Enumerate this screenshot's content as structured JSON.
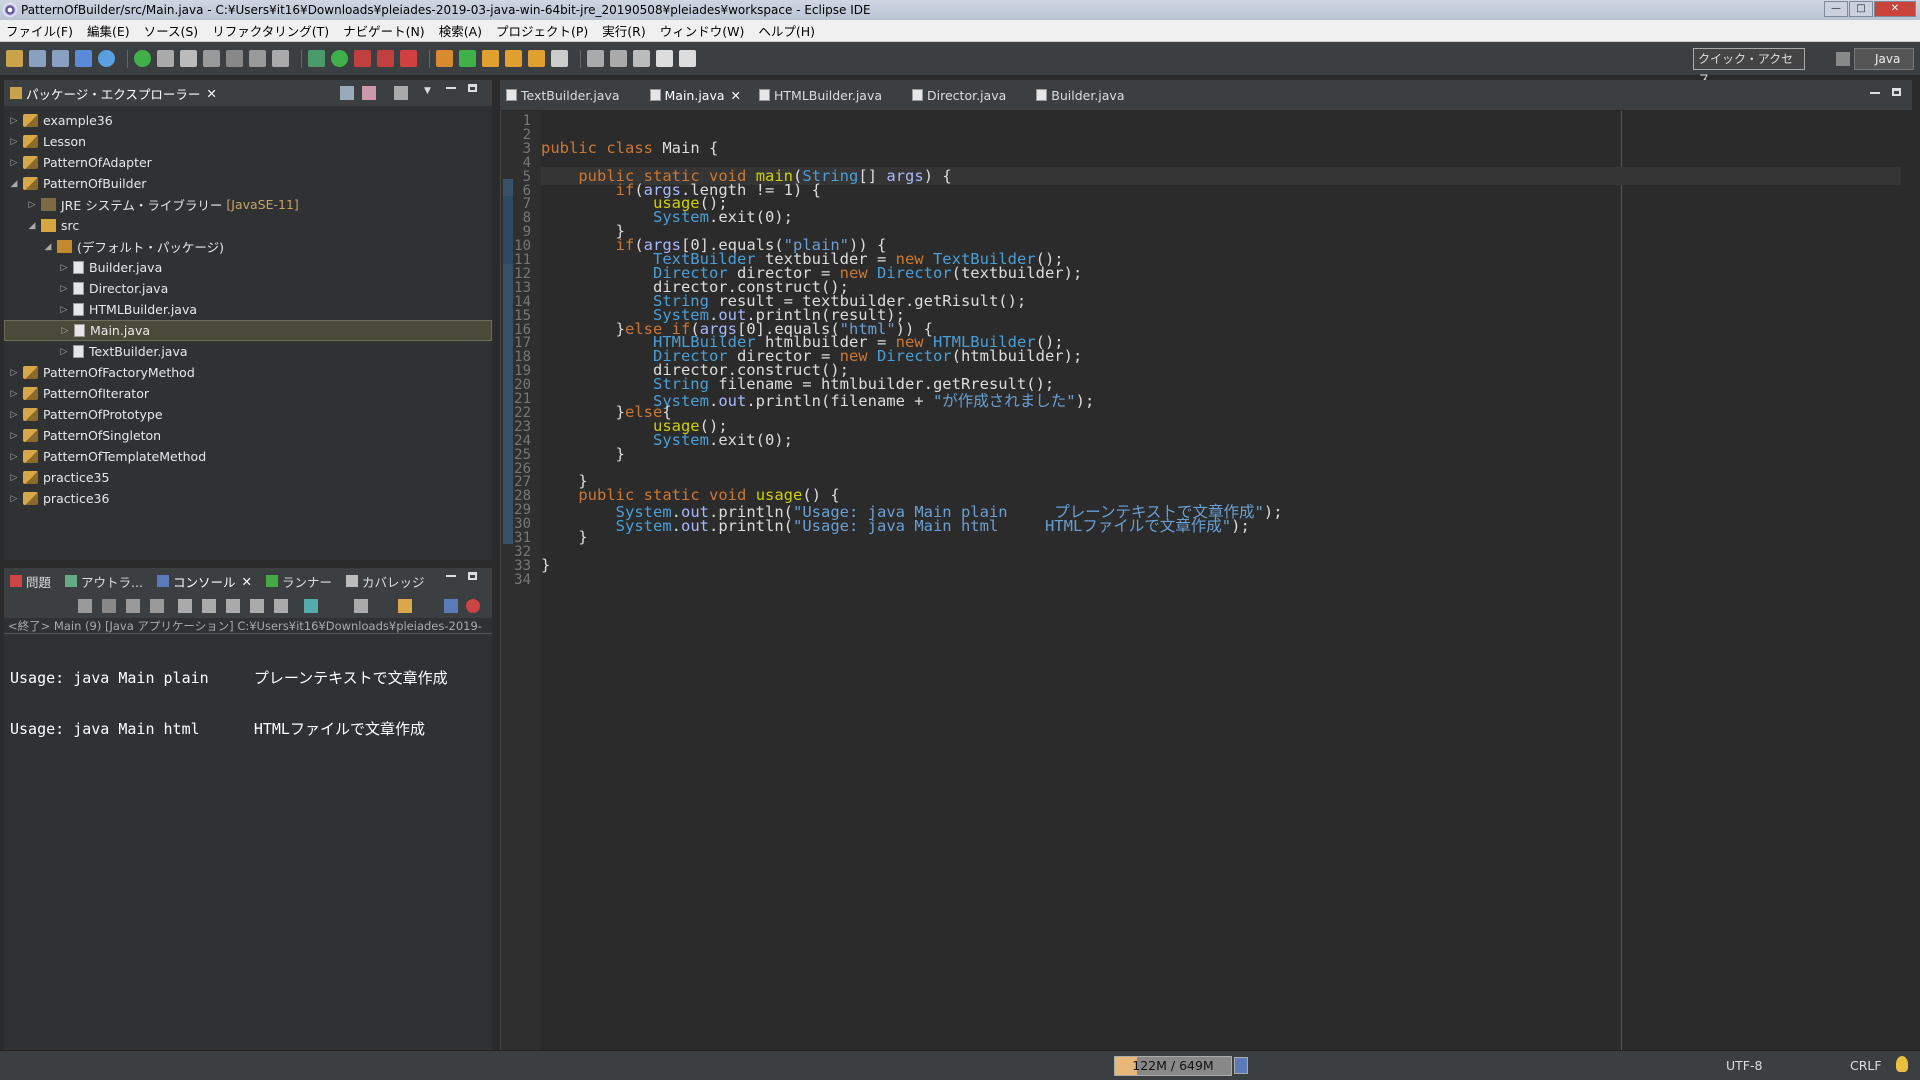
{
  "window": {
    "title": "PatternOfBuilder/src/Main.java - C:¥Users¥it16¥Downloads¥pleiades-2019-03-java-win-64bit-jre_20190508¥pleiades¥workspace - Eclipse IDE"
  },
  "menu": [
    "ファイル(F)",
    "編集(E)",
    "ソース(S)",
    "リファクタリング(T)",
    "ナビゲート(N)",
    "検索(A)",
    "プロジェクト(P)",
    "実行(R)",
    "ウィンドウ(W)",
    "ヘルプ(H)"
  ],
  "toolbar": {
    "quick_access": "クイック・アクセス",
    "perspective": "Java"
  },
  "explorer": {
    "tab_label": "パッケージ・エクスプローラー",
    "items": [
      {
        "label": "example36",
        "deco": ""
      },
      {
        "label": "Lesson",
        "deco": ""
      },
      {
        "label": "PatternOfAdapter",
        "deco": ""
      },
      {
        "label": "PatternOfBuilder",
        "deco": ""
      },
      {
        "label": "JRE システム・ライブラリー",
        "deco": "[JavaSE-11]"
      },
      {
        "label": "src",
        "deco": ""
      },
      {
        "label": "(デフォルト・パッケージ)",
        "deco": ""
      },
      {
        "label": "Builder.java",
        "deco": ""
      },
      {
        "label": "Director.java",
        "deco": ""
      },
      {
        "label": "HTMLBuilder.java",
        "deco": ""
      },
      {
        "label": "Main.java",
        "deco": ""
      },
      {
        "label": "TextBuilder.java",
        "deco": ""
      },
      {
        "label": "PatternOfFactoryMethod",
        "deco": ""
      },
      {
        "label": "PatternOfIterator",
        "deco": ""
      },
      {
        "label": "PatternOfPrototype",
        "deco": ""
      },
      {
        "label": "PatternOfSingleton",
        "deco": ""
      },
      {
        "label": "PatternOfTemplateMethod",
        "deco": ""
      },
      {
        "label": "practice35",
        "deco": ""
      },
      {
        "label": "practice36",
        "deco": ""
      }
    ]
  },
  "editor_tabs": [
    "TextBuilder.java",
    "Main.java",
    "HTMLBuilder.java",
    "Director.java",
    "Builder.java"
  ],
  "bottom_tabs": [
    "問題",
    "アウトラ...",
    "コンソール",
    "ランナー",
    "カバレッジ"
  ],
  "console": {
    "path": "<終了> Main (9) [Java アプリケーション] C:¥Users¥it16¥Downloads¥pleiades-2019-",
    "lines": [
      "Usage: java Main plain     プレーンテキストで文章作成",
      "Usage: java Main html      HTMLファイルで文章作成"
    ]
  },
  "code_lines": [
    "",
    "",
    "public class Main {",
    "",
    "    public static void main(String[] args) {",
    "        if(args.length != 1) {",
    "            usage();",
    "            System.exit(0);",
    "        }",
    "        if(args[0].equals(\"plain\")) {",
    "            TextBuilder textbuilder = new TextBuilder();",
    "            Director director = new Director(textbuilder);",
    "            director.construct();",
    "            String result = textbuilder.getRisult();",
    "            System.out.println(result);",
    "        }else if(args[0].equals(\"html\")) {",
    "            HTMLBuilder htmlbuilder = new HTMLBuilder();",
    "            Director director = new Director(htmlbuilder);",
    "            director.construct();",
    "            String filename = htmlbuilder.getRresult();",
    "            System.out.println(filename + \"が作成されました\");",
    "        }else{",
    "            usage();",
    "            System.exit(0);",
    "        }",
    "",
    "    }",
    "    public static void usage() {",
    "        System.out.println(\"Usage: java Main plain     プレーンテキストで文章作成\");",
    "        System.out.println(\"Usage: java Main html     HTMLファイルで文章作成\");",
    "    }",
    "",
    "}",
    ""
  ],
  "status": {
    "heap": "122M / 649M",
    "heap_used_fraction": 0.19,
    "encoding": "UTF-8",
    "line_ending": "CRLF"
  }
}
